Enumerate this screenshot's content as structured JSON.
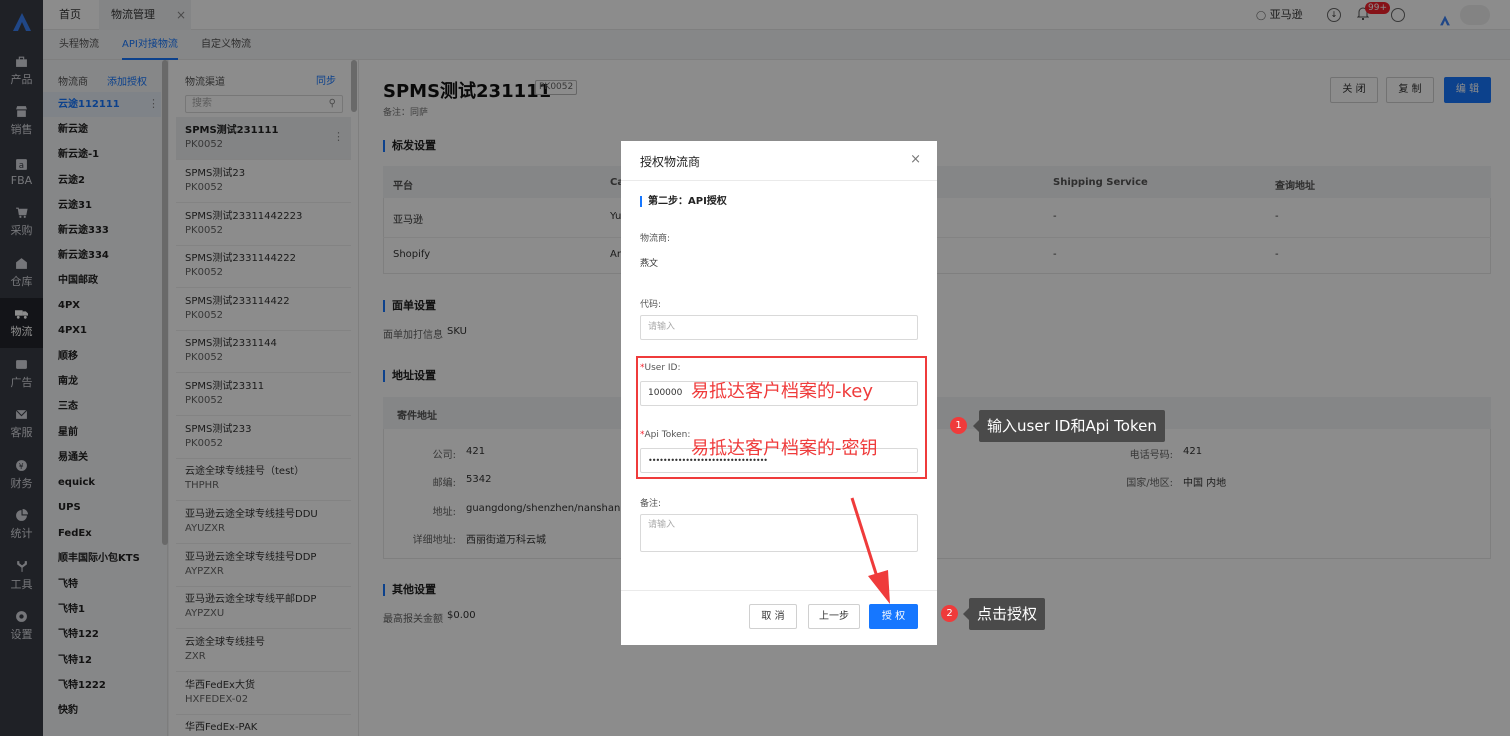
{
  "nav": {
    "items": [
      {
        "label": "产品",
        "icon": "bag-icon"
      },
      {
        "label": "销售",
        "icon": "store-icon"
      },
      {
        "label": "FBA",
        "icon": "amazon-icon"
      },
      {
        "label": "采购",
        "icon": "cart-icon"
      },
      {
        "label": "仓库",
        "icon": "warehouse-icon"
      },
      {
        "label": "物流",
        "icon": "truck-icon"
      },
      {
        "label": "广告",
        "icon": "ad-icon"
      },
      {
        "label": "客服",
        "icon": "mail-icon"
      },
      {
        "label": "财务",
        "icon": "finance-icon"
      },
      {
        "label": "统计",
        "icon": "pie-chart-icon"
      },
      {
        "label": "工具",
        "icon": "tools-icon"
      },
      {
        "label": "设置",
        "icon": "gear-icon"
      }
    ]
  },
  "tabs": {
    "home": "首页",
    "logistics": "物流管理",
    "close": "×"
  },
  "topbar": {
    "shop": "亚马逊",
    "badge": "99+"
  },
  "subnav": {
    "items": [
      "头程物流",
      "API对接物流",
      "自定义物流"
    ]
  },
  "carrier": {
    "header": "物流商",
    "add": "添加授权",
    "items": [
      "云途112111",
      "新云途",
      "新云途-1",
      "云途2",
      "云途31",
      "新云途333",
      "新云途334",
      "中国邮政",
      "4PX",
      "4PX1",
      "顺移",
      "南龙",
      "三态",
      "星前",
      "易通关",
      "equick",
      "UPS",
      "FedEx",
      "顺丰国际小包KTS",
      "飞特",
      "飞特1",
      "飞特122",
      "飞特12",
      "飞特1222",
      "快豹"
    ]
  },
  "channel": {
    "header": "物流渠道",
    "sync": "同步",
    "search_placeholder": "搜索",
    "items": [
      {
        "name": "SPMS测试231111",
        "code": "PK0052"
      },
      {
        "name": "SPMS测试23",
        "code": "PK0052"
      },
      {
        "name": "SPMS测试23311442223",
        "code": "PK0052"
      },
      {
        "name": "SPMS测试2331144222",
        "code": "PK0052"
      },
      {
        "name": "SPMS测试233114422",
        "code": "PK0052"
      },
      {
        "name": "SPMS测试2331144",
        "code": "PK0052"
      },
      {
        "name": "SPMS测试23311",
        "code": "PK0052"
      },
      {
        "name": "SPMS测试233",
        "code": "PK0052"
      },
      {
        "name": "云途全球专线挂号（test）",
        "code": "THPHR"
      },
      {
        "name": "亚马逊云途全球专线挂号DDU",
        "code": "AYUZXR"
      },
      {
        "name": "亚马逊云途全球专线挂号DDP",
        "code": "AYPZXR"
      },
      {
        "name": "亚马逊云途全球专线平邮DDP",
        "code": "AYPZXU"
      },
      {
        "name": "云途全球专线挂号",
        "code": "ZXR"
      },
      {
        "name": "华西FedEx大货",
        "code": "HXFEDEX-02"
      },
      {
        "name": "华西FedEx-PAK",
        "code": ""
      }
    ]
  },
  "detail": {
    "title": "SPMS测试231111",
    "code": "PK0052",
    "note": "备注：同萨",
    "buttons": {
      "close": "关 闭",
      "copy": "复 制",
      "edit": "编 辑"
    },
    "label_settings": {
      "title": "标发设置",
      "headers": [
        "平台",
        "Ca",
        "Shipping Service",
        "查询地址"
      ],
      "rows": [
        [
          "亚马逊",
          "Yu",
          "-",
          "-"
        ],
        [
          "Shopify",
          "Ar",
          "-",
          "-"
        ]
      ]
    },
    "waybill": {
      "title": "面单设置",
      "label": "面单加打信息",
      "value": "SKU"
    },
    "address": {
      "title": "地址设置",
      "sender_title": "寄件地址",
      "company_label": "公司:",
      "company": "421",
      "zip_label": "邮编:",
      "zip": "5342",
      "addr_label": "地址:",
      "addr": "guangdong/shenzhen/nanshan",
      "detail_label": "详细地址:",
      "detail": "西丽街道万科云城",
      "phone_label": "电话号码:",
      "phone": "421",
      "country_label": "国家/地区:",
      "country": "中国 内地"
    },
    "other": {
      "title": "其他设置",
      "label": "最高报关金额",
      "value": "$0.00"
    }
  },
  "modal": {
    "title": "授权物流商",
    "close": "×",
    "step": "第二步：API授权",
    "carrier_label": "物流商:",
    "carrier_value": "燕文",
    "code_label": "代码:",
    "code_placeholder": "请输入",
    "userid_label": "User ID:",
    "userid_value": "100000",
    "token_label": "Api Token:",
    "token_value": "••••••••••••••••••••••••••••••••",
    "remark_label": "备注:",
    "remark_placeholder": "请输入",
    "buttons": {
      "cancel": "取 消",
      "prev": "上一步",
      "auth": "授 权"
    }
  },
  "annotations": {
    "key_hint": "易抵达客户档案的-key",
    "secret_hint": "易抵达客户档案的-密钥",
    "step1_num": "1",
    "step1_text": "输入user ID和Api Token",
    "step2_num": "2",
    "step2_text": "点击授权"
  }
}
